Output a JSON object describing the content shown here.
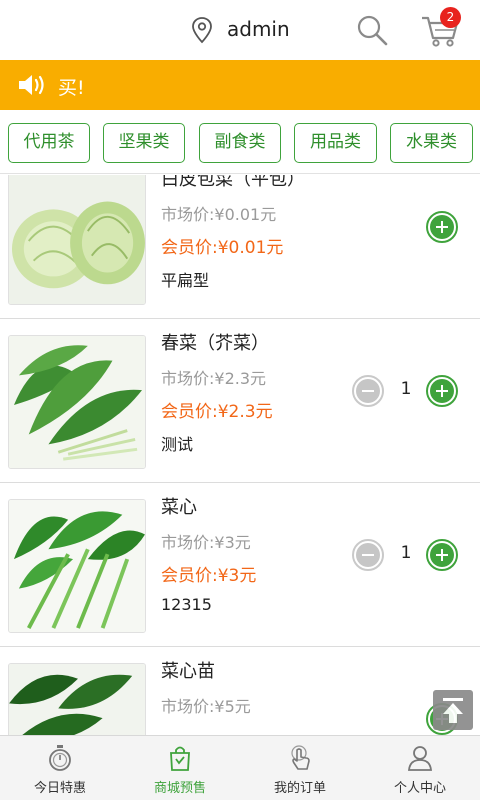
{
  "header": {
    "username": "admin",
    "cart_count": "2"
  },
  "notice": {
    "text": "买!"
  },
  "categories": [
    "代用茶",
    "坚果类",
    "副食类",
    "用品类",
    "水果类"
  ],
  "products": [
    {
      "name": "白皮包菜（平包）",
      "market_price": "市场价:¥0.01元",
      "member_price": "会员价:¥0.01元",
      "spec": "平扁型",
      "quantity": null,
      "image": "cabbage"
    },
    {
      "name": "春菜（芥菜）",
      "market_price": "市场价:¥2.3元",
      "member_price": "会员价:¥2.3元",
      "spec": "测试",
      "quantity": "1",
      "image": "mustard-greens"
    },
    {
      "name": "菜心",
      "market_price": "市场价:¥3元",
      "member_price": "会员价:¥3元",
      "spec": "12315",
      "quantity": "1",
      "image": "choy-sum"
    },
    {
      "name": "菜心苗",
      "market_price": "市场价:¥5元",
      "member_price": "",
      "spec": "",
      "quantity": null,
      "image": "choy-sum-seedling"
    }
  ],
  "tabs": [
    {
      "label": "今日特惠",
      "icon": "stopwatch-icon",
      "active": false
    },
    {
      "label": "商城预售",
      "icon": "shopping-bag-icon",
      "active": true
    },
    {
      "label": "我的订单",
      "icon": "touch-hand-icon",
      "active": false
    },
    {
      "label": "个人中心",
      "icon": "user-icon",
      "active": false
    }
  ],
  "colors": {
    "accent_green": "#3fa33c",
    "notice_orange": "#f9ad00",
    "member_price": "#f26718",
    "badge_red": "#e8231e"
  }
}
